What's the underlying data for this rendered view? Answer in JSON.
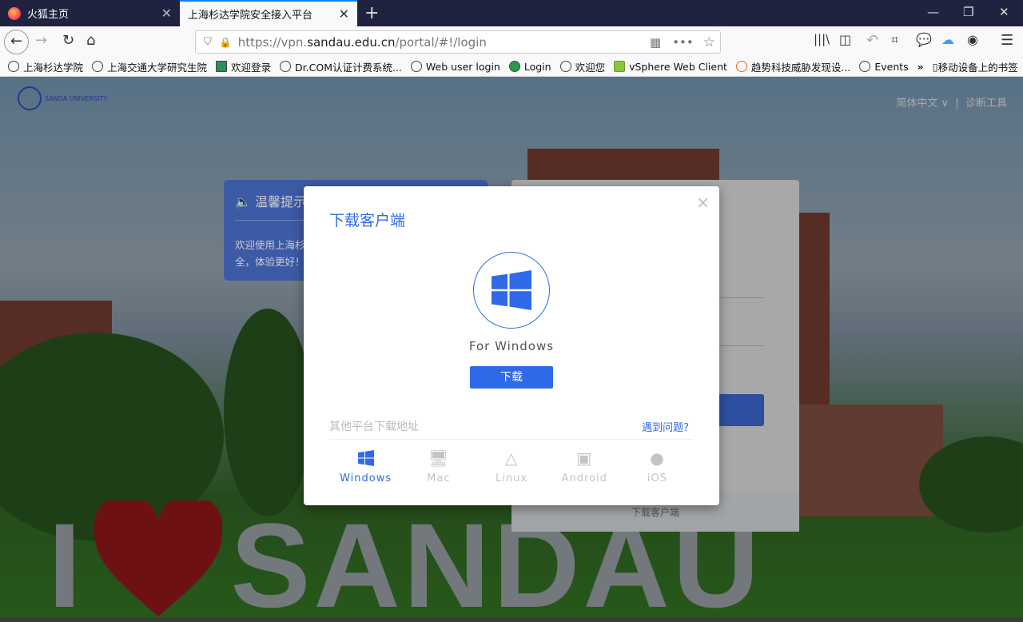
{
  "browser": {
    "tabs": [
      {
        "label": "火狐主页",
        "active": false
      },
      {
        "label": "上海杉达学院安全接入平台",
        "active": true
      }
    ],
    "url": {
      "prefix": "https://vpn.",
      "host": "sandau.edu.cn",
      "path": "/portal/#!/login"
    },
    "bookmarks": [
      "上海杉达学院",
      "上海交通大学研究生院",
      "欢迎登录",
      "Dr.COM认证计费系统...",
      "Web user login",
      "Login",
      "欢迎您",
      "vSphere Web Client",
      "趋势科技威胁发现设...",
      "Events"
    ],
    "mobile_bookmarks": "移动设备上的书签"
  },
  "page": {
    "logo_text": "SANDA UNIVERSITY",
    "language": "简体中文 ∨",
    "diagnostics": "诊断工具",
    "notice": {
      "title": "温馨提示",
      "text": "欢迎使用上海杉",
      "text2": "全，体验更好！"
    },
    "login_footer": "下载客户端",
    "sign": "SANDAU"
  },
  "modal": {
    "title": "下载客户端",
    "close": "×",
    "platform_label": "For Windows",
    "download_button": "下载",
    "other_platforms": "其他平台下载地址",
    "problem_link": "遇到问题?",
    "platforms": [
      {
        "label": "Windows",
        "icon": "windows-icon",
        "active": true
      },
      {
        "label": "Mac",
        "icon": "mac-icon"
      },
      {
        "label": "Linux",
        "icon": "linux-icon"
      },
      {
        "label": "Android",
        "icon": "android-icon"
      },
      {
        "label": "iOS",
        "icon": "apple-icon"
      }
    ],
    "accent": "#2f6be8"
  }
}
